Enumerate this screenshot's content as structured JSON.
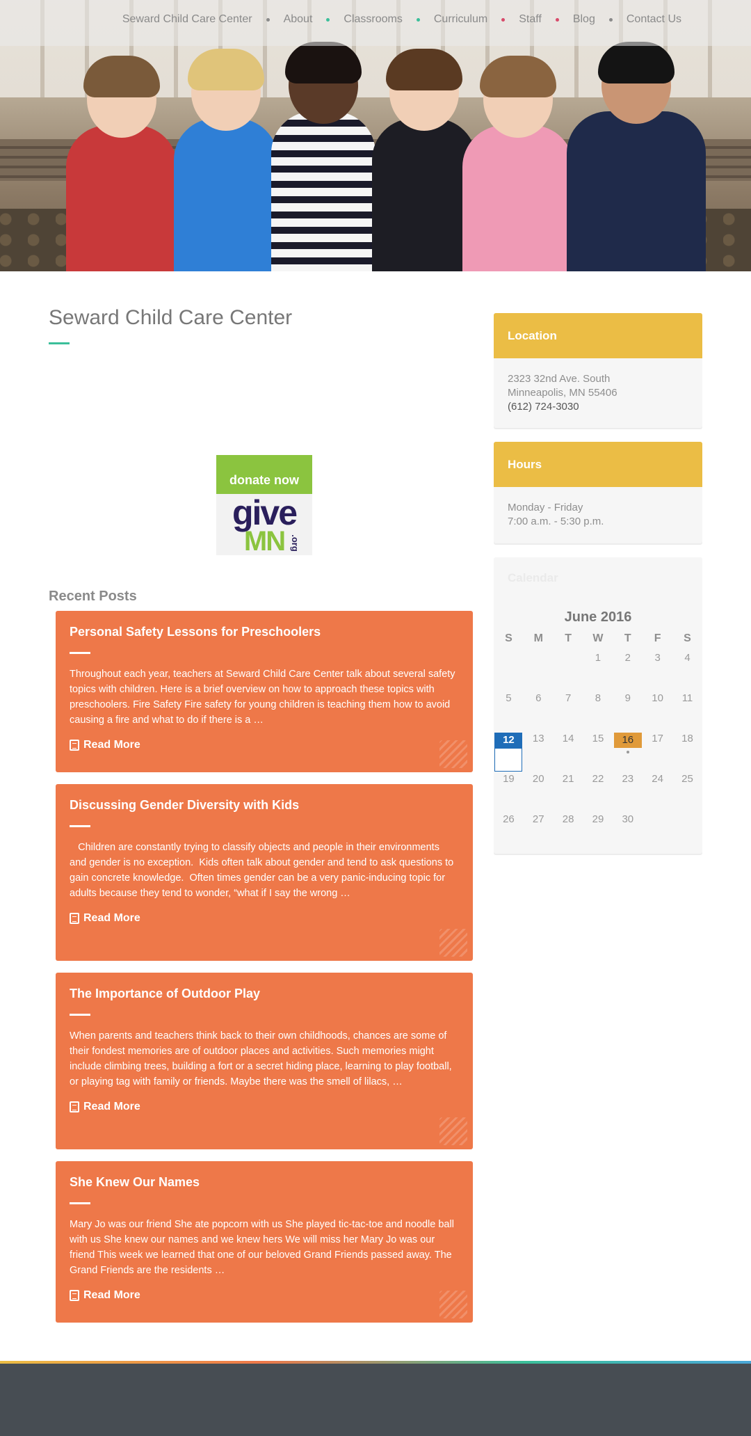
{
  "nav": {
    "items": [
      "Seward Child Care Center",
      "About",
      "Classrooms",
      "Curriculum",
      "Staff",
      "Blog",
      "Contact Us"
    ],
    "dot_colors": [
      "#3bbf9a",
      "#3bbf9a",
      "#4aa7d8",
      "#ee7849",
      "#d84a6a",
      "#8a8a8a"
    ]
  },
  "main": {
    "title": "Seward Child Care Center",
    "donate": {
      "top": "donate now",
      "give": "give",
      "mn": "MN",
      "org": ".org"
    },
    "recent_posts_heading": "Recent Posts",
    "read_more_label": "Read More",
    "posts": [
      {
        "title": "Personal Safety Lessons for Preschoolers",
        "excerpt": "Throughout each year, teachers at Seward Child Care Center talk about several safety topics with children. Here is a brief overview on how to approach these topics with preschoolers.   Fire Safety   Fire safety for young children is teaching them how to avoid causing a fire and what to do if there is a …"
      },
      {
        "title": "Discussing Gender Diversity with Kids",
        "excerpt": "   Children are constantly trying to classify objects and people in their environments and gender is no exception.  Kids often talk about gender and tend to ask questions to gain concrete knowledge.  Often times gender can be a very panic-inducing topic for adults because they tend to wonder, “what if I say the wrong …"
      },
      {
        "title": "The Importance of Outdoor Play",
        "excerpt": "When parents and teachers think back to their own childhoods, chances are some of their fondest memories are of outdoor places and activities. Such memories might include climbing trees, building a fort or a secret hiding place, learning to play football, or playing tag with family or friends. Maybe there was the smell of lilacs, …"
      },
      {
        "title": "She Knew Our Names",
        "excerpt": "Mary Jo was our friend She ate popcorn with us She played tic-tac-toe and noodle ball with us She knew our names and we knew hers We will miss her Mary Jo was our friend   This week we learned that one of our beloved Grand Friends passed away.  The Grand Friends are the residents …"
      }
    ]
  },
  "sidebar": {
    "location": {
      "heading": "Location",
      "address1": "2323 32nd Ave. South",
      "address2": "Minneapolis, MN 55406",
      "phone": "(612) 724-3030"
    },
    "hours": {
      "heading": "Hours",
      "days": "Monday - Friday",
      "times": "7:00 a.m. - 5:30 p.m."
    },
    "calendar": {
      "heading": "Calendar",
      "month": "June 2016",
      "dow": [
        "S",
        "M",
        "T",
        "W",
        "T",
        "F",
        "S"
      ],
      "weeks": [
        [
          "",
          "",
          "",
          "1",
          "2",
          "3",
          "4"
        ],
        [
          "5",
          "6",
          "7",
          "8",
          "9",
          "10",
          "11"
        ],
        [
          "12",
          "13",
          "14",
          "15",
          "16",
          "17",
          "18"
        ],
        [
          "19",
          "20",
          "21",
          "22",
          "23",
          "24",
          "25"
        ],
        [
          "26",
          "27",
          "28",
          "29",
          "30",
          "",
          ""
        ]
      ],
      "today": "12",
      "event_day": "16"
    }
  },
  "colors": {
    "accent_yellow": "#ebbd45",
    "post_orange": "#ee7849",
    "title_teal": "#3bbf9a",
    "today_blue": "#1f6db8",
    "footer": "#474d53"
  }
}
